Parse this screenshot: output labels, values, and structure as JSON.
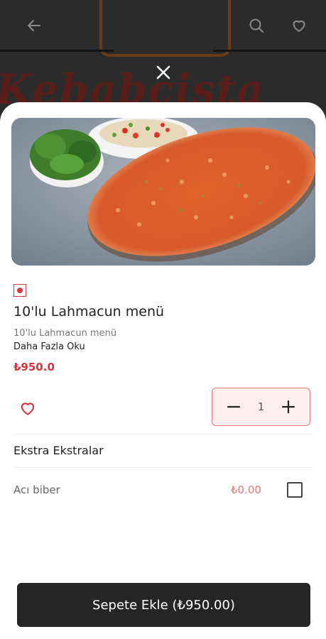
{
  "header": {
    "icons": {
      "back": "arrow-left-icon",
      "search": "search-icon",
      "favorite": "heart-icon",
      "close": "close-icon"
    },
    "background_brand_text": "Kebabcista"
  },
  "product": {
    "image_alt": "Lahmacun with salad and greens",
    "badge_icon": "veg-indicator-icon",
    "title": "10'lu Lahmacun menü",
    "description": "10'lu Lahmacun menü",
    "read_more": "Daha Fazla Oku",
    "price": "₺950.0",
    "quantity": "1"
  },
  "extras": {
    "section_title": "Ekstra Ekstralar",
    "items": [
      {
        "label": "Acı biber",
        "price": "₺0.00",
        "checked": false
      }
    ]
  },
  "cart": {
    "button_label": "Sepete Ekle (₺950.00)"
  },
  "colors": {
    "accent": "#d8333b",
    "stepper_border": "#e07a7a",
    "stepper_bg": "#fdeff0",
    "button_bg": "#252525"
  }
}
